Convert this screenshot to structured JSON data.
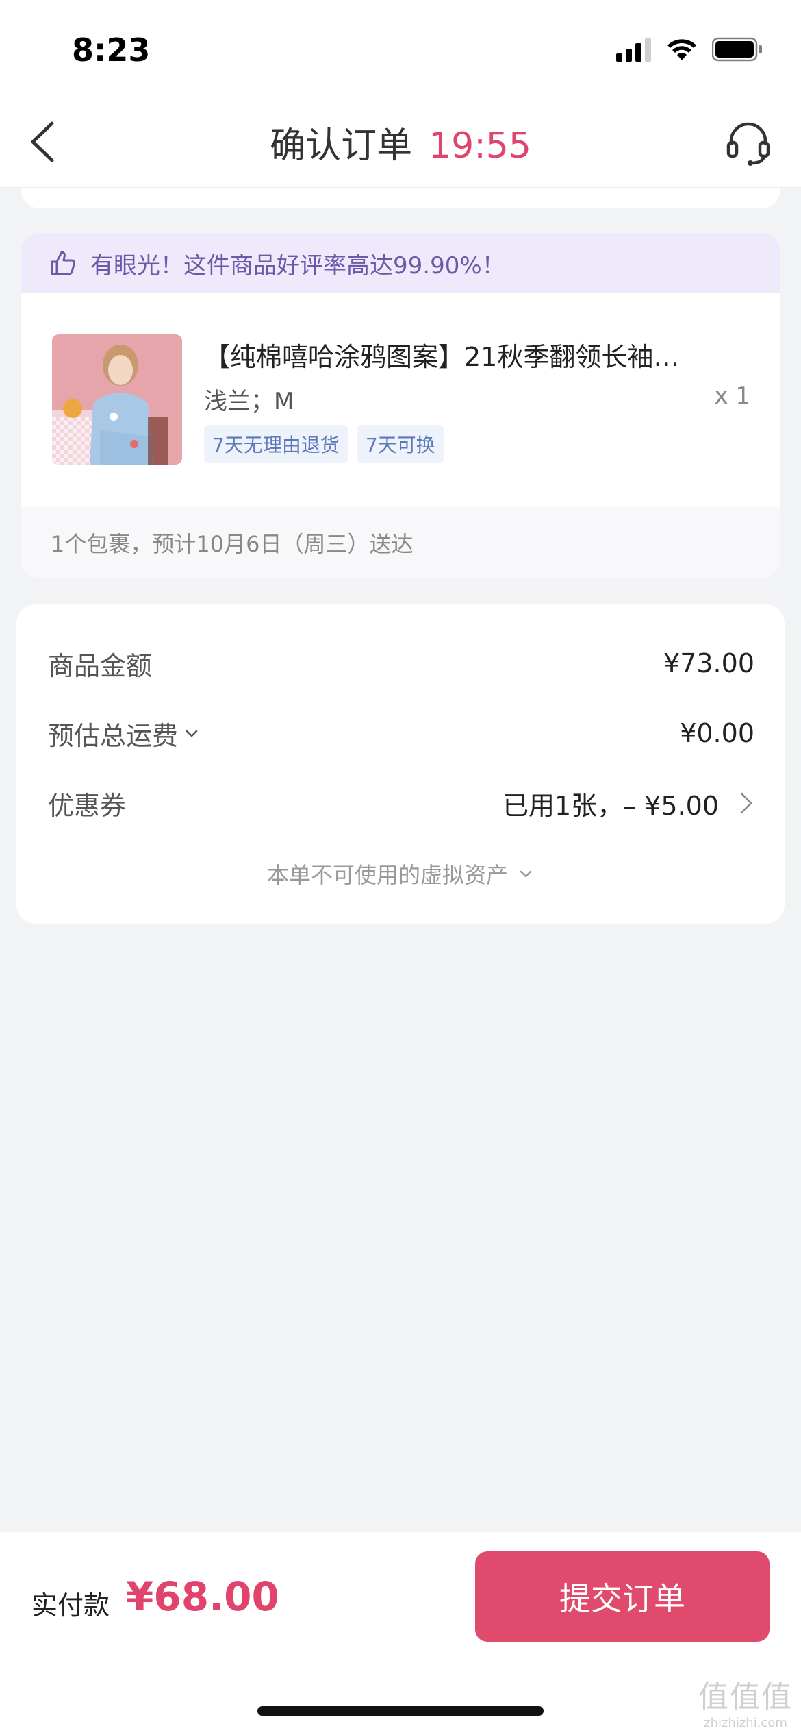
{
  "status_bar": {
    "time": "8:23"
  },
  "nav": {
    "title": "确认订单",
    "timer": "19:55"
  },
  "praise": {
    "text": "有眼光！这件商品好评率高达99.90%！"
  },
  "product": {
    "title": "【纯棉嘻哈涂鸦图案】21秋季翻领长袖…",
    "spec": "浅兰；M",
    "quantity": "x 1",
    "tags": [
      "7天无理由退货",
      "7天可换"
    ],
    "delivery": "1个包裹，预计10月6日（周三）送达"
  },
  "pricing": {
    "goods_label": "商品金额",
    "goods_value": "¥73.00",
    "shipping_label": "预估总运费",
    "shipping_value": "¥0.00",
    "coupon_label": "优惠券",
    "coupon_value": "已用1张，– ¥5.00",
    "virtual_assets": "本单不可使用的虚拟资产"
  },
  "bottom": {
    "pay_label": "实付款",
    "pay_amount": "¥68.00",
    "submit_label": "提交订单"
  },
  "watermark": {
    "big": "值值值",
    "small": "zhizhizhi.com"
  },
  "colors": {
    "accent": "#e0436b",
    "button": "#e04b6d",
    "praise_bg": "#eeeafb"
  }
}
